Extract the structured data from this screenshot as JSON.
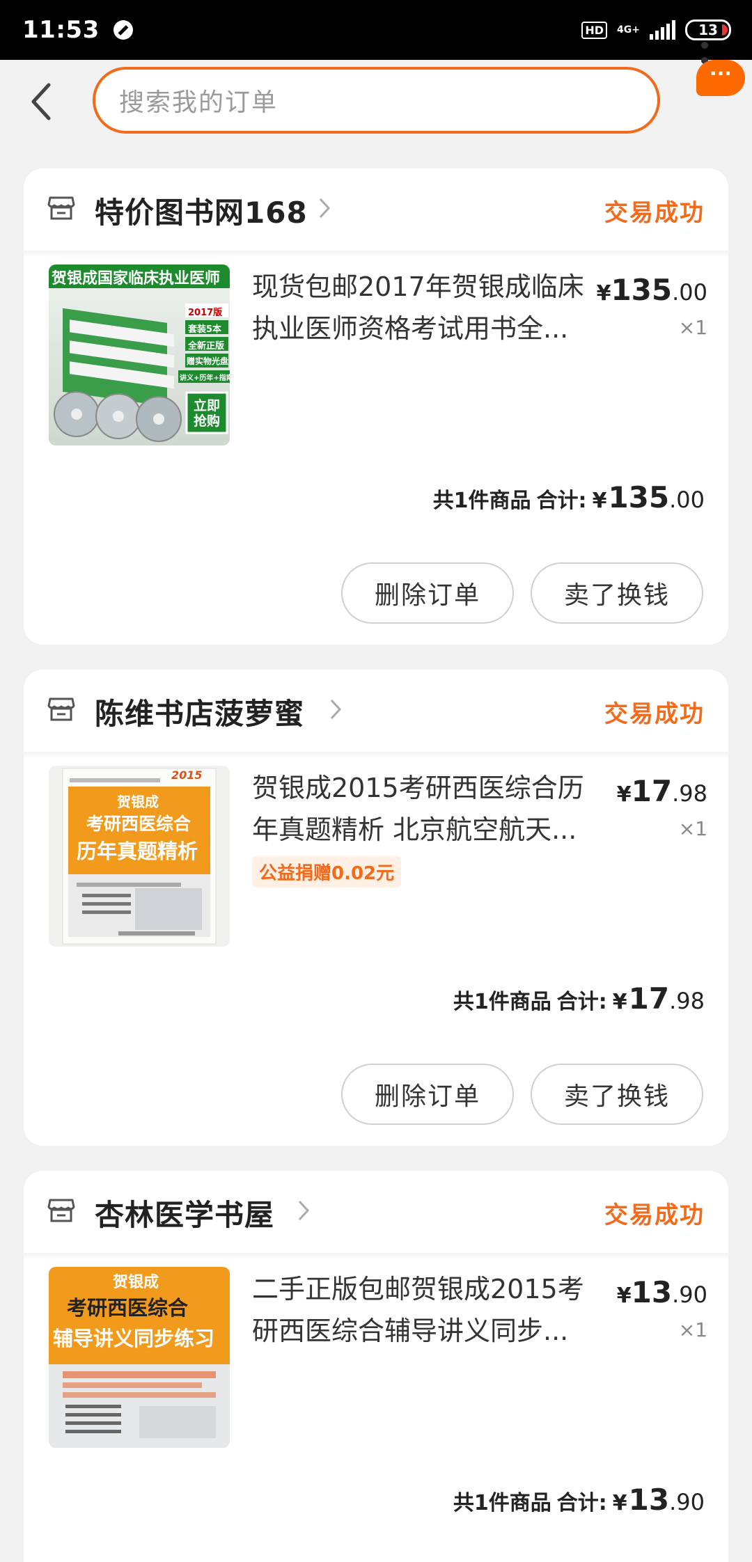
{
  "status_bar": {
    "time": "11:53",
    "hd": "HD",
    "network": "4G+",
    "battery": "13"
  },
  "header": {
    "search_placeholder": "搜索我的订单",
    "more_badge": "···"
  },
  "orders": [
    {
      "shop": "特价图书网168",
      "status": "交易成功",
      "title_line1": "现货包邮2017年贺银成临床",
      "title_line2": "执业医师资格考试用书全...",
      "price_currency": "¥",
      "price_int": "135",
      "price_dec": ".00",
      "quantity": "×1",
      "summary": "共1件商品",
      "total_label": "合计:",
      "total_currency": "¥",
      "total_int": "135",
      "total_dec": ".00",
      "btn_delete": "删除订单",
      "btn_sell": "卖了换钱",
      "thumb": {
        "banner": "贺银成国家临床执业医师",
        "badge1": "2017版",
        "badge2": "套装5本",
        "badge3": "全新正版",
        "badge4": "赠实物光盘",
        "badge5": "讲义+历年+指南",
        "cta": "立即抢购"
      }
    },
    {
      "shop": "陈维书店菠萝蜜",
      "status": "交易成功",
      "title_line1": "贺银成2015考研西医综合历",
      "title_line2": "年真题精析 北京航空航天...",
      "tag": "公益捐赠0.02元",
      "price_currency": "¥",
      "price_int": "17",
      "price_dec": ".98",
      "quantity": "×1",
      "summary": "共1件商品",
      "total_label": "合计:",
      "total_currency": "¥",
      "total_int": "17",
      "total_dec": ".98",
      "btn_delete": "删除订单",
      "btn_sell": "卖了换钱",
      "thumb": {
        "year": "2015",
        "author": "贺银成",
        "line1": "考研西医综合",
        "line2": "历年真题精析"
      }
    },
    {
      "shop": "杏林医学书屋",
      "status": "交易成功",
      "title_line1": "二手正版包邮贺银成2015考",
      "title_line2": "研西医综合辅导讲义同步...",
      "price_currency": "¥",
      "price_int": "13",
      "price_dec": ".90",
      "quantity": "×1",
      "summary": "共1件商品",
      "total_label": "合计:",
      "total_currency": "¥",
      "total_int": "13",
      "total_dec": ".90",
      "thumb": {
        "author": "贺银成",
        "line1": "考研西医综合",
        "line2": "辅导讲义同步练习"
      }
    }
  ],
  "colors": {
    "accent": "#f26a1b",
    "background": "#f2f2f2"
  }
}
